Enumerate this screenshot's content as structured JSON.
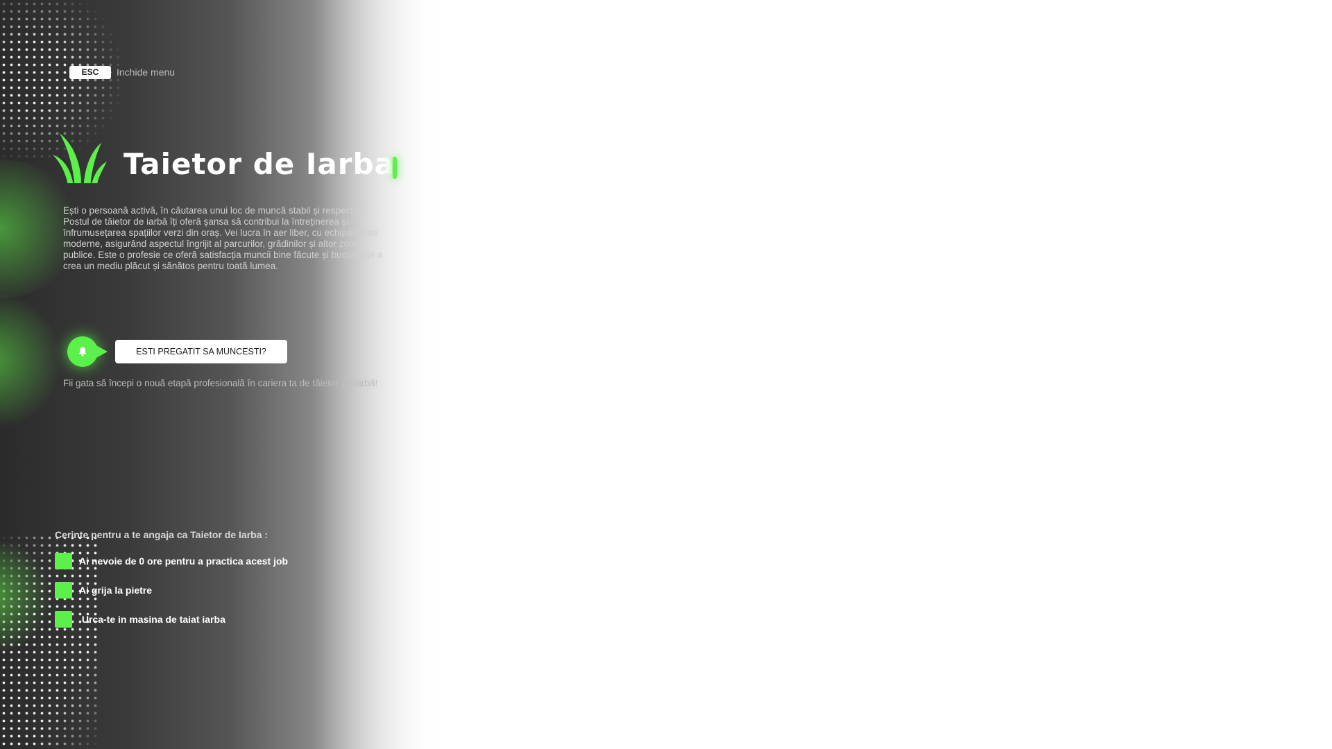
{
  "esc": {
    "key_label": "ESC",
    "action_label": "Inchide menu"
  },
  "job": {
    "title": "Taietor de Iarba",
    "description": "Ești o persoană activă, în căutarea unui loc de muncă stabil și respectat? Postul de tăietor de iarbă îți oferă șansa să contribui la întreținerea și înfrumusețarea spațiilor verzi din oraș. Vei lucra în aer liber, cu echipamente moderne, asigurând aspectul îngrijit al parcurilor, grădinilor și altor zone publice. Este o profesie ce oferă satisfacția muncii bine făcute și bucuria de a crea un mediu plăcut și sănătos pentru toată lumea."
  },
  "cta": {
    "button_label": "ESTI PREGATIT SA MUNCESTI?",
    "subtitle": "Fii gata să începi o nouă etapă profesională în cariera ta de tăietor de iarbă!"
  },
  "requirements": {
    "title": "Cerinte pentru a te angaja ca Taietor de Iarba :",
    "items": [
      {
        "label": "Ai nevoie de 0 ore pentru a practica acest job"
      },
      {
        "label": "Ai grija la pietre"
      },
      {
        "label": " Urca-te in masina de taiat iarba"
      }
    ]
  },
  "colors": {
    "accent": "#5cf04a",
    "background_dark": "#2b2b2b",
    "background_light": "#ffffff"
  },
  "icons": {
    "logo": "grass-icon",
    "cta": "bell-icon"
  }
}
